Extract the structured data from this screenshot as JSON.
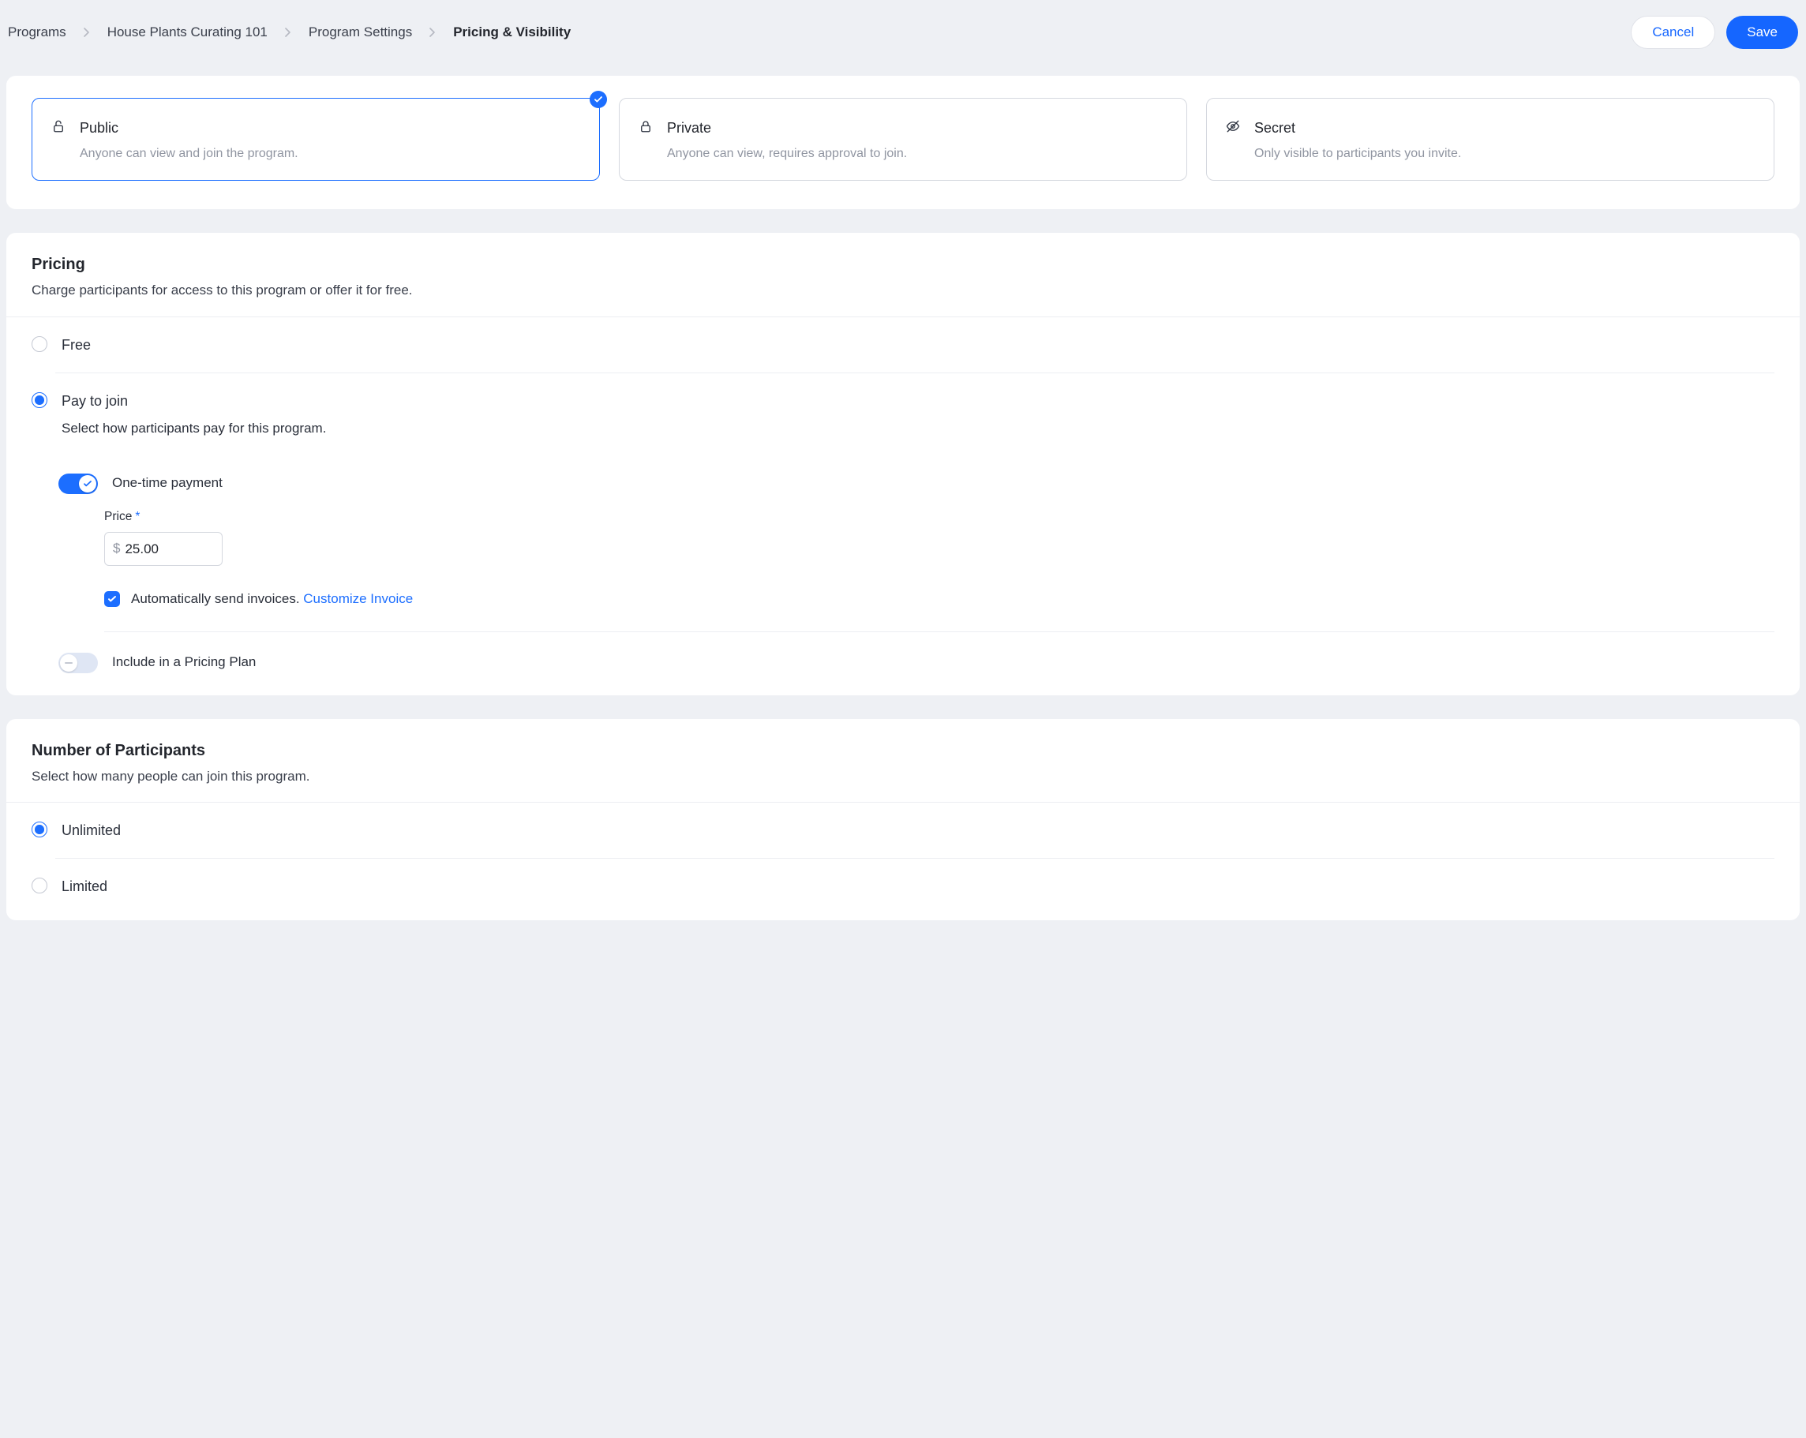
{
  "breadcrumb": {
    "items": [
      "Programs",
      "House Plants Curating 101",
      "Program Settings",
      "Pricing & Visibility"
    ]
  },
  "header": {
    "cancel": "Cancel",
    "save": "Save"
  },
  "visibility": {
    "cards": [
      {
        "title": "Public",
        "desc": "Anyone can view and join the program."
      },
      {
        "title": "Private",
        "desc": "Anyone can view, requires approval to join."
      },
      {
        "title": "Secret",
        "desc": "Only visible to participants you invite."
      }
    ]
  },
  "pricing": {
    "title": "Pricing",
    "subtitle": "Charge participants for access to this program or offer it for free.",
    "free_label": "Free",
    "pay_label": "Pay to join",
    "pay_desc": "Select how participants pay for this program.",
    "one_time_label": "One-time payment",
    "price_label": "Price",
    "currency": "$",
    "price_value": "25.00",
    "invoice_text": "Automatically send invoices. ",
    "invoice_link": "Customize Invoice",
    "plan_label": "Include in a Pricing Plan"
  },
  "participants": {
    "title": "Number of Participants",
    "subtitle": "Select how many people can join this program.",
    "unlimited": "Unlimited",
    "limited": "Limited"
  }
}
